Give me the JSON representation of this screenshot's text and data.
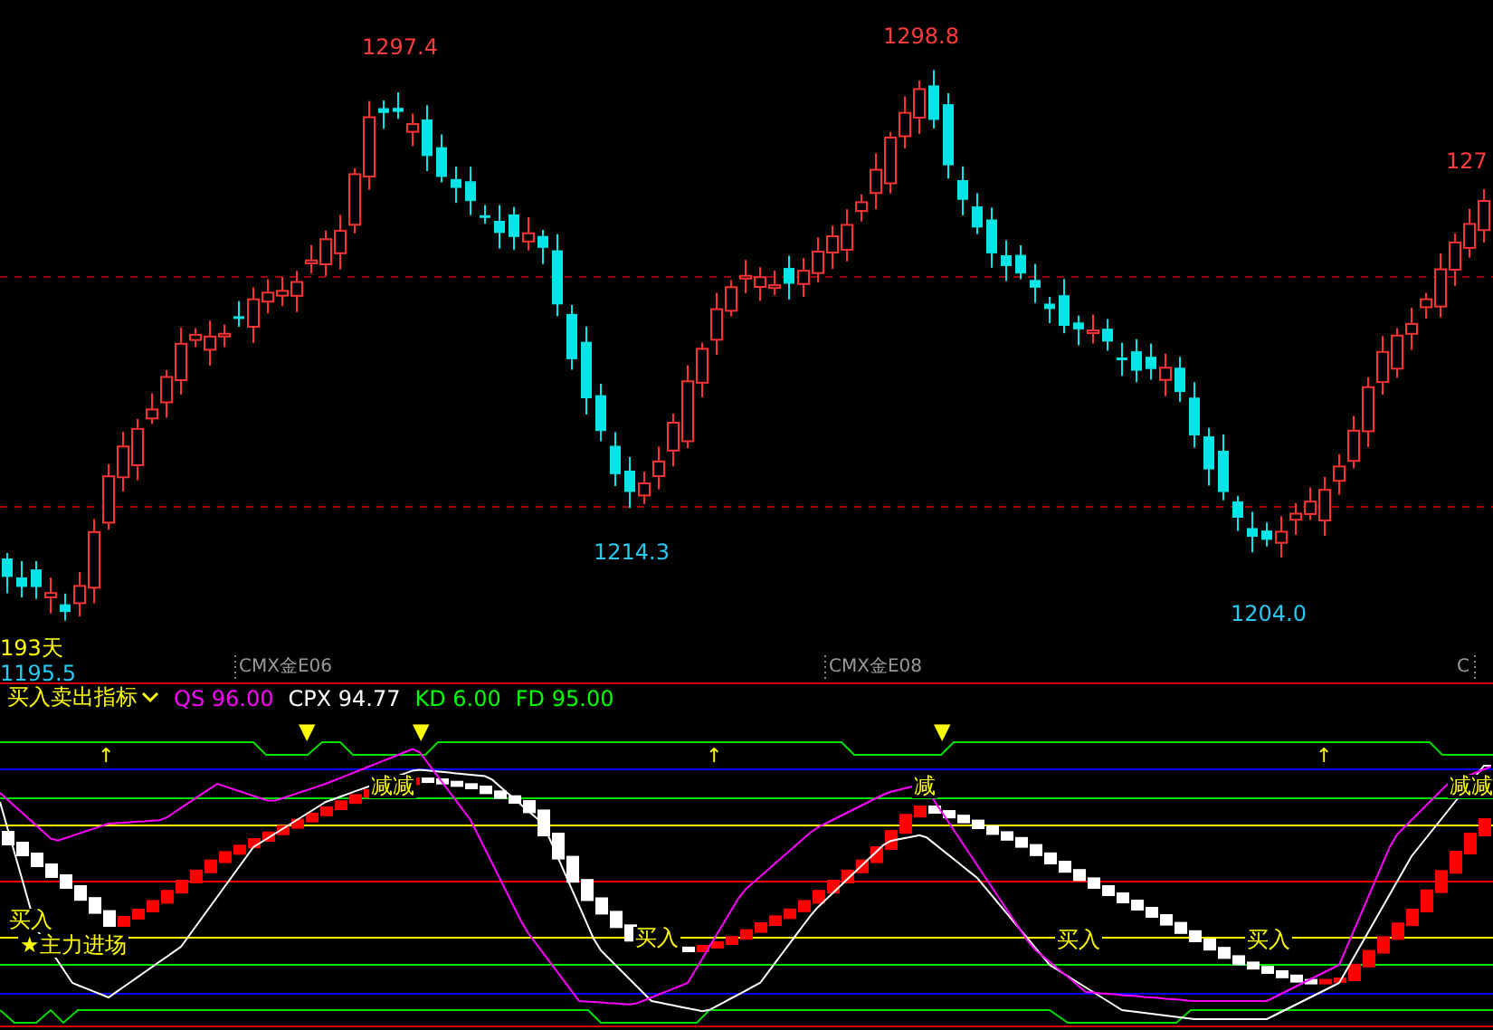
{
  "price_chart": {
    "labels": [
      {
        "kind": "high",
        "text": "1297.4"
      },
      {
        "kind": "high",
        "text": "1298.8"
      },
      {
        "kind": "high",
        "text": "127"
      },
      {
        "kind": "low",
        "text": "1214.3"
      },
      {
        "kind": "low",
        "text": "1204.0"
      },
      {
        "kind": "low",
        "text": "1195.5"
      },
      {
        "kind": "days",
        "text": "193天"
      }
    ],
    "axis_labels": [
      "CMX金E06",
      "CMX金E08",
      "C"
    ]
  },
  "indicator": {
    "name": "买入卖出指标",
    "values": [
      {
        "name": "QS",
        "value": "96.00",
        "color": "#ff00ff"
      },
      {
        "name": "CPX",
        "value": "94.77",
        "color": "#ffffff"
      },
      {
        "name": "KD",
        "value": "6.00",
        "color": "#00ff00"
      },
      {
        "name": "FD",
        "value": "95.00",
        "color": "#00ff00"
      }
    ],
    "signals": [
      "买入",
      "★主力进场",
      "减减",
      "买入",
      "减",
      "买入",
      "买入",
      "减减"
    ],
    "markers": [
      {
        "kind": "arrow",
        "text": "↑"
      },
      {
        "kind": "triangle",
        "text": "▼"
      },
      {
        "kind": "triangle",
        "text": "▼"
      },
      {
        "kind": "arrow",
        "text": "↑"
      },
      {
        "kind": "triangle",
        "text": "▼"
      },
      {
        "kind": "arrow",
        "text": "↑"
      }
    ]
  }
}
